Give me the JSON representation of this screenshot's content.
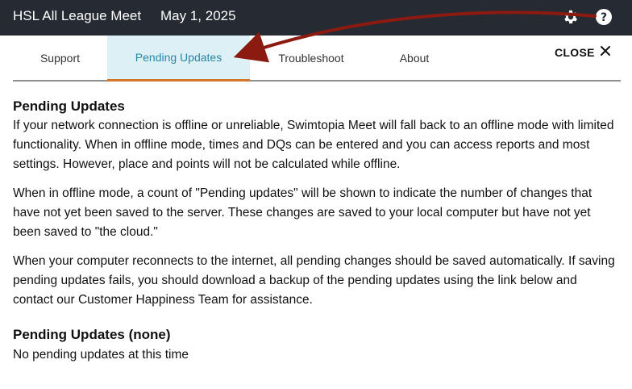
{
  "header": {
    "meet_title": "HSL All League Meet",
    "meet_date": "May 1, 2025",
    "icons": [
      "gear-icon",
      "help-icon"
    ]
  },
  "tabs": [
    {
      "label": "Support",
      "active": false
    },
    {
      "label": "Pending Updates",
      "active": true
    },
    {
      "label": "Troubleshoot",
      "active": false
    },
    {
      "label": "About",
      "active": false
    }
  ],
  "close_label": "CLOSE",
  "content": {
    "heading": "Pending Updates",
    "paragraphs": [
      "If your network connection is offline or unreliable, Swimtopia Meet will fall back to an offline mode with limited functionality. When in offline mode, times and DQs can be entered and you can access reports and most settings. However, place and points will not be calculated while offline.",
      "When in offline mode, a count of \"Pending updates\" will be shown to indicate the number of changes that have not yet been saved to the server. These changes are saved to your local computer but have not yet been saved to \"the cloud.\"",
      "When your computer reconnects to the internet, all pending changes should be saved automatically. If saving pending updates fails, you should download a backup of the pending updates using the link below and contact our Customer Happiness Team for assistance."
    ],
    "pending_heading": "Pending Updates (none)",
    "pending_status": "No pending updates at this time"
  },
  "colors": {
    "topbar": "#262a33",
    "active_tab_bg": "#dcf0f5",
    "active_tab_text": "#2a86a8",
    "active_tab_underline": "#d4762c",
    "annotation_arrow": "#8b1a10"
  }
}
